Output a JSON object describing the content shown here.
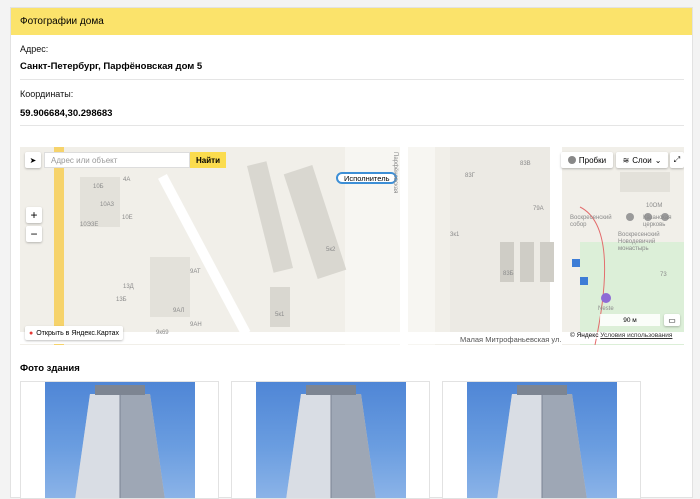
{
  "header": {
    "title": "Фотографии дома"
  },
  "address": {
    "label": "Адрес:",
    "value": "Санкт-Петербург, Парфёновская дом 5"
  },
  "coords": {
    "label": "Координаты:",
    "value": "59.906684,30.298683"
  },
  "map": {
    "search_placeholder": "Адрес или объект",
    "find_label": "Найти",
    "traffic_label": "Пробки",
    "layers_label": "Слои",
    "open_in_maps_label": "Открыть в Яндекс.Картах",
    "pin_label": "Исполнитель",
    "scale_label": "90 м",
    "copyright_label": "© Яндекс",
    "terms_label": "Условия использования",
    "street_label": "Малая Митрофаньевская ул.",
    "labels": {
      "l1": "4А",
      "l2": "10Б",
      "l3": "10А3",
      "l4": "10Э3Е",
      "l5": "10Е",
      "l6": "9АТ",
      "l7": "13Д",
      "l8": "13Б",
      "l9": "9АЛ",
      "l10": "9АН",
      "l11": "9к69",
      "l12": "5к2",
      "l13": "5к1",
      "l14": "83Г",
      "l15": "83Б",
      "l16": "83В",
      "l17": "79А",
      "l18": "3к1",
      "l19": "73",
      "l20": "10ОМ",
      "l21": "Воскресенский собор",
      "l22": "Воскресенский Новодевичий монастырь",
      "l23": "Казанская церковь",
      "l24": "Neste",
      "l25": "Парфёновская"
    }
  },
  "photos": {
    "title": "Фото здания",
    "count": 3
  }
}
